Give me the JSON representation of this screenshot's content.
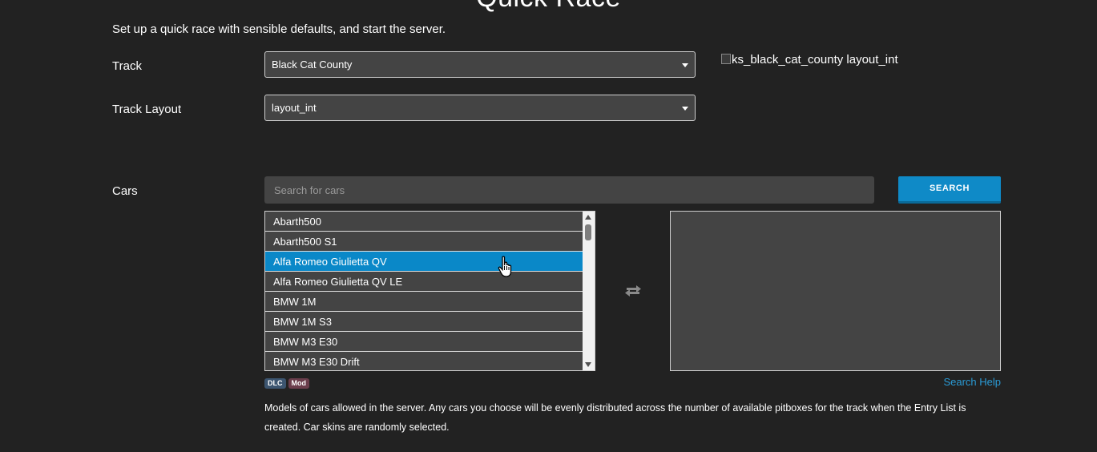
{
  "page": {
    "title": "Quick Race",
    "subtitle": "Set up a quick race with sensible defaults, and start the server."
  },
  "track": {
    "label": "Track",
    "selected": "Black Cat County",
    "image_alt": "ks_black_cat_county layout_int"
  },
  "layout": {
    "label": "Track Layout",
    "selected": "layout_int"
  },
  "cars": {
    "label": "Cars",
    "search_placeholder": "Search for cars",
    "search_button": "SEARCH",
    "items": [
      {
        "name": "Abarth500",
        "selected": false
      },
      {
        "name": "Abarth500 S1",
        "selected": false
      },
      {
        "name": "Alfa Romeo Giulietta QV",
        "selected": true
      },
      {
        "name": "Alfa Romeo Giulietta QV LE",
        "selected": false
      },
      {
        "name": "BMW 1M",
        "selected": false
      },
      {
        "name": "BMW 1M S3",
        "selected": false
      },
      {
        "name": "BMW M3 E30",
        "selected": false
      },
      {
        "name": "BMW M3 E30 Drift",
        "selected": false
      }
    ],
    "badges": [
      "DLC",
      "Mod"
    ],
    "search_help": "Search Help",
    "help_text": "Models of cars allowed in the server. Any cars you choose will be evenly distributed across the number of available pitboxes for the track when the Entry List is created. Car skins are randomly selected."
  },
  "colors": {
    "background": "#222222",
    "input_bg": "#444444",
    "accent": "#0a88c8",
    "link": "#2a9bd6"
  },
  "icons": [
    "caret-down-icon",
    "broken-image-icon",
    "swap-arrows-icon",
    "hand-cursor-icon"
  ]
}
